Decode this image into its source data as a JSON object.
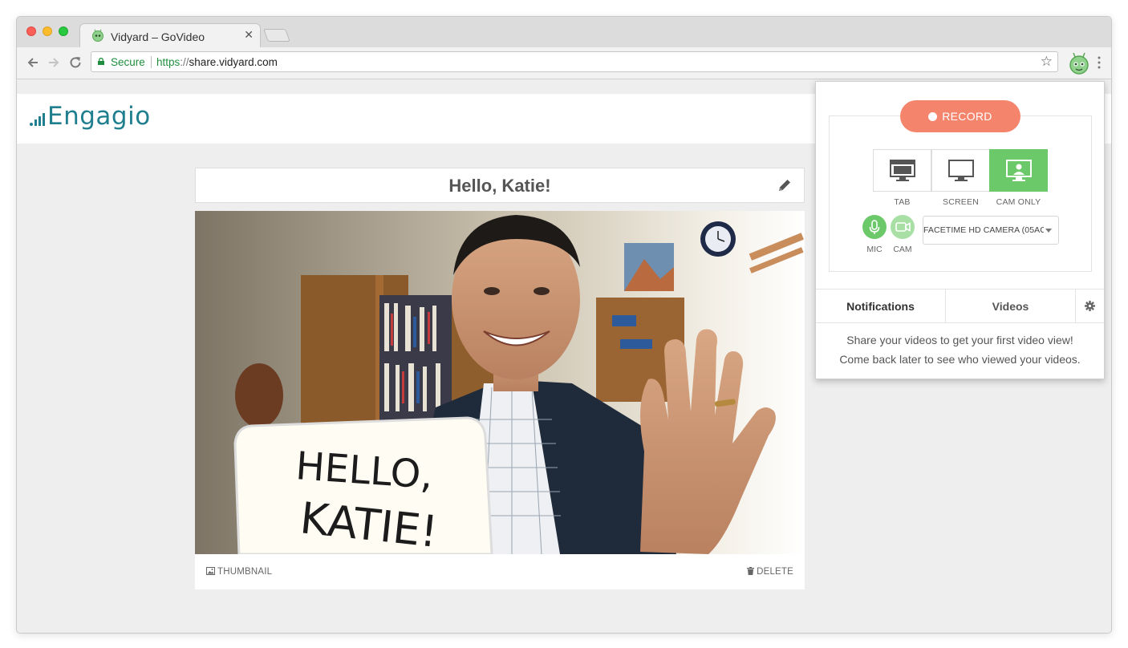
{
  "browser": {
    "tab_title": "Vidyard – GoVideo",
    "tab_close": "✕",
    "secure_label": "Secure",
    "url_scheme": "https",
    "url_sep": "://",
    "url_host": "share.vidyard.com"
  },
  "page": {
    "logo_text": "Engagio",
    "title": "Hello, Katie!",
    "thumbnail_label": "THUMBNAIL",
    "delete_label": "DELETE",
    "whiteboard_line1": "HELLO,",
    "whiteboard_line2": "KATIE!"
  },
  "popup": {
    "record_label": "RECORD",
    "modes": [
      {
        "label": "TAB"
      },
      {
        "label": "SCREEN"
      },
      {
        "label": "CAM ONLY"
      }
    ],
    "mic_label": "MIC",
    "cam_label": "CAM",
    "camera_select": "FACETIME HD CAMERA (05AC:",
    "tabs": {
      "notifications": "Notifications",
      "videos": "Videos"
    },
    "message_line1": "Share your videos to get your first video view!",
    "message_line2": "Come back later to see who viewed your videos."
  },
  "colors": {
    "record": "#f4846c",
    "active_green": "#6cc96a",
    "logo_teal": "#1f7f8f"
  },
  "icons": [
    "vidyard-icon",
    "lock-icon",
    "back-icon",
    "forward-icon",
    "reload-icon",
    "star-icon",
    "menu-icon",
    "edit-icon",
    "image-icon",
    "trash-icon",
    "gear-icon",
    "mic-icon",
    "camera-icon",
    "tab-icon",
    "screen-icon",
    "cam-only-icon"
  ]
}
